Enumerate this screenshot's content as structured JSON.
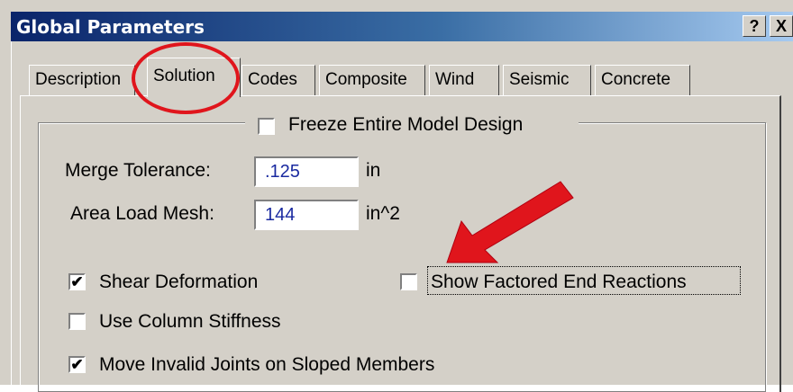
{
  "window": {
    "title": "Global Parameters",
    "help_label": "?",
    "close_label": "X"
  },
  "tabs": [
    {
      "label": "Description"
    },
    {
      "label": "Solution"
    },
    {
      "label": "Codes"
    },
    {
      "label": "Composite"
    },
    {
      "label": "Wind"
    },
    {
      "label": "Seismic"
    },
    {
      "label": "Concrete"
    }
  ],
  "solution": {
    "freeze": {
      "label": "Freeze Entire Model Design",
      "checked": false
    },
    "merge_tolerance": {
      "label": "Merge Tolerance:",
      "value": ".125",
      "unit": "in"
    },
    "area_load_mesh": {
      "label": "Area Load Mesh:",
      "value": "144",
      "unit": "in^2"
    },
    "shear_deformation": {
      "label": "Shear Deformation",
      "checked": true,
      "mark": "✔"
    },
    "show_factored_end_reactions": {
      "label": "Show Factored End Reactions",
      "checked": false
    },
    "use_column_stiffness": {
      "label": "Use Column Stiffness",
      "checked": false
    },
    "move_invalid_joints": {
      "label": "Move Invalid Joints on Sloped Members",
      "checked": true,
      "mark": "✔"
    }
  },
  "annotations": {
    "highlight_color": "#e0151c",
    "arrow_color": "#e0151c"
  }
}
